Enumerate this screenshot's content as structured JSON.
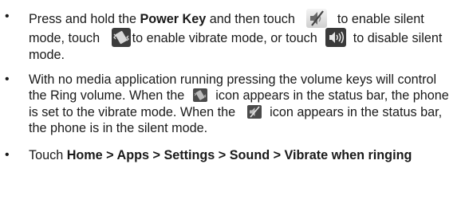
{
  "items": [
    {
      "t1": "Press and hold the ",
      "b1": "Power Key",
      "t2": " and then touch",
      "t3": "to enable silent mode, touch",
      "t4": "to enable vibrate mode, or touch",
      "t5": "to disable silent mode.",
      "icons": [
        "silent-mode-icon",
        "vibrate-mode-icon",
        "sound-on-icon"
      ]
    },
    {
      "t1": "With no media application running pressing the volume keys will control the Ring volume. When the",
      "t2": "icon appears in the status bar, the phone is set to the vibrate mode. When the",
      "t3": "icon appears in the status bar, the phone is in the silent mode.",
      "icons": [
        "vibrate-status-icon",
        "silent-status-icon"
      ]
    },
    {
      "t1": "Touch ",
      "b1": "Home > Apps > Settings > Sound > Vibrate when ringing"
    }
  ],
  "bullet_char": "•",
  "colors": {
    "icon_dark": "#3a3a3a",
    "icon_light": "#e8e8e8",
    "text": "#1a1a1a"
  }
}
